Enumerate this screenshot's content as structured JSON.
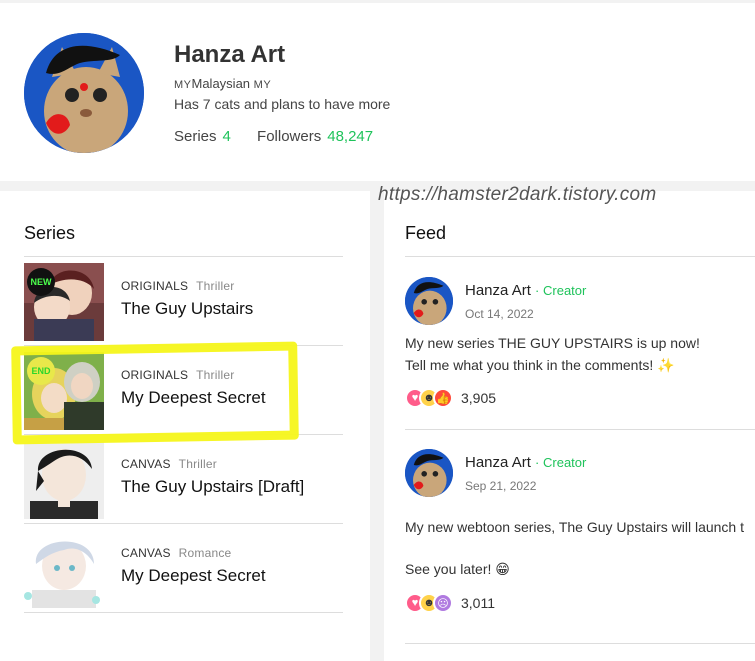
{
  "profile": {
    "name": "Hanza Art",
    "country_prefix": "MY",
    "country": "Malaysian",
    "country_suffix": "MY",
    "bio": "Has 7 cats and plans to have more",
    "series_label": "Series",
    "series_count": "4",
    "followers_label": "Followers",
    "followers_count": "48,247"
  },
  "watermark": "https://hamster2dark.tistory.com",
  "series": {
    "title": "Series",
    "items": [
      {
        "type": "ORIGINALS",
        "genre": "Thriller",
        "title": "The Guy Upstairs",
        "badge": "NEW"
      },
      {
        "type": "ORIGINALS",
        "genre": "Thriller",
        "title": "My Deepest Secret",
        "badge": "END"
      },
      {
        "type": "CANVAS",
        "genre": "Thriller",
        "title": "The Guy Upstairs [Draft]",
        "badge": ""
      },
      {
        "type": "CANVAS",
        "genre": "Romance",
        "title": "My Deepest Secret",
        "badge": ""
      }
    ]
  },
  "feed": {
    "title": "Feed",
    "posts": [
      {
        "author": "Hanza Art",
        "role": "Creator",
        "date": "Oct 14, 2022",
        "lines": [
          "My new series THE GUY UPSTAIRS is up now!",
          "Tell me what you think in the comments! ✨"
        ],
        "reactions": [
          "heart",
          "laugh",
          "thumbs-up"
        ],
        "count": "3,905"
      },
      {
        "author": "Hanza Art",
        "role": "Creator",
        "date": "Sep 21, 2022",
        "lines": [
          "My new webtoon series, The Guy Upstairs will launch t",
          "See you later! 😁"
        ],
        "reactions": [
          "heart",
          "laugh",
          "shocked"
        ],
        "count": "3,011"
      }
    ]
  },
  "colors": {
    "accent_green": "#1fc35b",
    "highlight_yellow": "#f5f51a",
    "avatar_blue": "#1a56c4"
  }
}
